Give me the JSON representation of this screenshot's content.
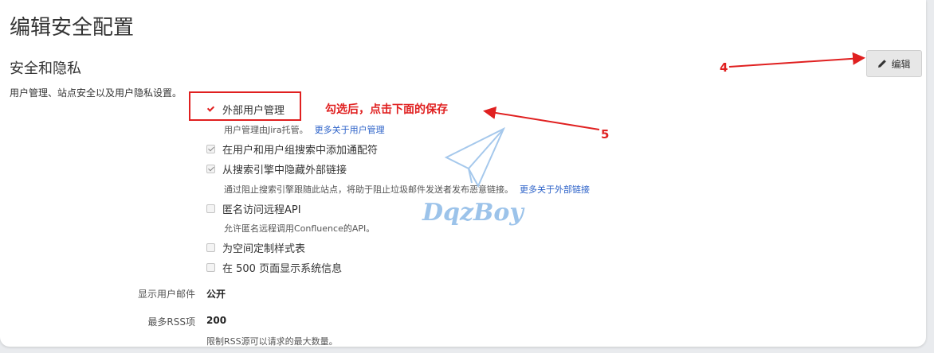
{
  "page": {
    "title": "编辑安全配置"
  },
  "section": {
    "title": "安全和隐私",
    "description": "用户管理、站点安全以及用户隐私设置。",
    "edit_label": "编辑"
  },
  "options": [
    {
      "label": "外部用户管理",
      "checked": true,
      "sub": "用户管理由Jira托管。",
      "link": "更多关于用户管理"
    },
    {
      "label": "在用户和用户组搜索中添加通配符",
      "checked": true
    },
    {
      "label": "从搜索引擎中隐藏外部链接",
      "checked": true,
      "sub": "通过阻止搜索引擎跟随此站点，将助于阻止垃圾邮件发送者发布恶意链接。",
      "link": "更多关于外部链接"
    },
    {
      "label": "匿名访问远程API",
      "checked": false,
      "sub": "允许匿名远程调用Confluence的API。"
    },
    {
      "label": "为空间定制样式表",
      "checked": false
    },
    {
      "label": "在 500 页面显示系统信息",
      "checked": false
    }
  ],
  "fields": {
    "email_label": "显示用户邮件",
    "email_value": "公开",
    "rss_label": "最多RSS项",
    "rss_value": "200",
    "rss_desc": "限制RSS源可以请求的最大数量。"
  },
  "annotations": {
    "note": "勾选后，点击下面的保存",
    "step4": "4",
    "step5": "5",
    "watermark": "DqzBoy"
  },
  "colors": {
    "annotation": "#e02020",
    "link": "#2b61c8",
    "watermark": "#9cc3ea"
  }
}
